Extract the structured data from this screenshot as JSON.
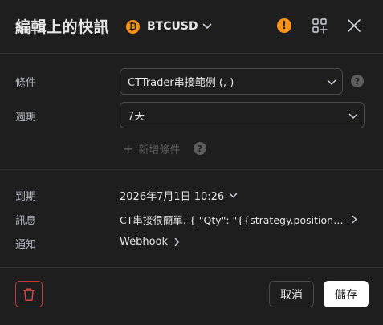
{
  "header": {
    "title": "編輯上的快訊",
    "symbol_icon": "bitcoin-icon",
    "symbol_icon_glyph": "₿",
    "symbol": "BTCUSD",
    "warning_glyph": "!"
  },
  "condition": {
    "label": "條件",
    "value": "CTTrader串接範例 (, )"
  },
  "period": {
    "label": "週期",
    "value": "7天"
  },
  "add_condition": {
    "plus": "+",
    "label": "新增條件"
  },
  "help_glyph": "?",
  "expiry": {
    "label": "到期",
    "value": "2026年7月1日 10:26"
  },
  "message": {
    "label": "訊息",
    "value": "CT串接很簡單. { \"Qty\": \"{{strategy.position_size}}\" }"
  },
  "notify": {
    "label": "通知",
    "value": "Webhook"
  },
  "footer": {
    "cancel_label": "取消",
    "save_label": "儲存"
  },
  "colors": {
    "background": "#1e1e1e",
    "accent_orange": "#f7931a",
    "danger": "#c73b3b",
    "save_bg": "#ffffff"
  }
}
